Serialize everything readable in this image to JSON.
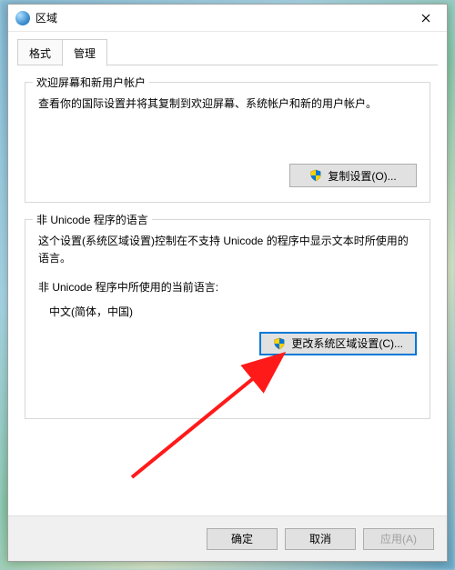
{
  "window": {
    "title": "区域",
    "close_aria": "关闭"
  },
  "tabs": {
    "format": "格式",
    "admin": "管理"
  },
  "welcome_group": {
    "legend": "欢迎屏幕和新用户帐户",
    "desc": "查看你的国际设置并将其复制到欢迎屏幕、系统帐户和新的用户帐户。",
    "copy_settings_btn": "复制设置(O)..."
  },
  "nonunicode_group": {
    "legend": "非 Unicode 程序的语言",
    "desc": "这个设置(系统区域设置)控制在不支持 Unicode 的程序中显示文本时所使用的语言。",
    "current_lang_label": "非 Unicode 程序中所使用的当前语言:",
    "current_lang_value": "中文(简体，中国)",
    "change_locale_btn": "更改系统区域设置(C)..."
  },
  "footer": {
    "ok": "确定",
    "cancel": "取消",
    "apply": "应用(A)"
  },
  "icons": {
    "globe": "globe-icon",
    "shield": "uac-shield-icon",
    "close": "close-icon"
  }
}
